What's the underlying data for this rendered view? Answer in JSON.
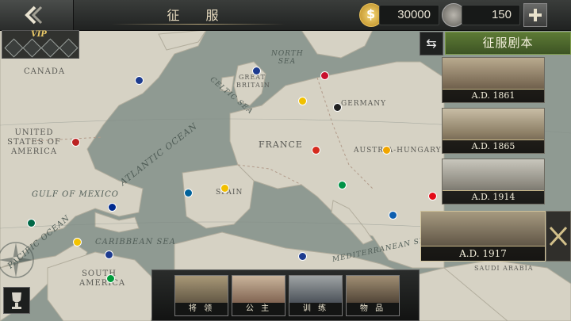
{
  "header": {
    "title": "征 服",
    "gold": "30000",
    "medals": "150"
  },
  "vip": {
    "label": "VIP"
  },
  "scenarios": {
    "header": "征服剧本",
    "cards": [
      {
        "year": "A.D. 1861"
      },
      {
        "year": "A.D. 1865"
      },
      {
        "year": "A.D. 1914"
      },
      {
        "year": "A.D. 1917"
      }
    ]
  },
  "bottom_menu": [
    {
      "label": "将 领"
    },
    {
      "label": "公 主"
    },
    {
      "label": "训 练"
    },
    {
      "label": "物 品"
    }
  ],
  "map_labels": {
    "canada": "CANADA",
    "usa": "UNITED STATES OF AMERICA",
    "atlantic": "ATLANTIC OCEAN",
    "gulf": "GULF OF MEXICO",
    "caribbean": "CARIBBEAN SEA",
    "south_america": "SOUTH AMERICA",
    "pacific": "PACIFIC OCEAN",
    "celtic": "CELTIC SEA",
    "north_sea": "NORTH SEA",
    "britain": "GREAT BRITAIN",
    "france": "FRANCE",
    "spain": "SPAIN",
    "germany": "GERMANY",
    "austria": "AUSTRIA-HUNGARY",
    "mediterranean": "MEDITERRANEAN SEA",
    "saudi": "SAUDI ARABIA"
  },
  "colors": {
    "land": "#d6d2c4",
    "sea": "#8f9a92",
    "accent_green": "#5d7a35",
    "gold": "#e0b64e"
  }
}
